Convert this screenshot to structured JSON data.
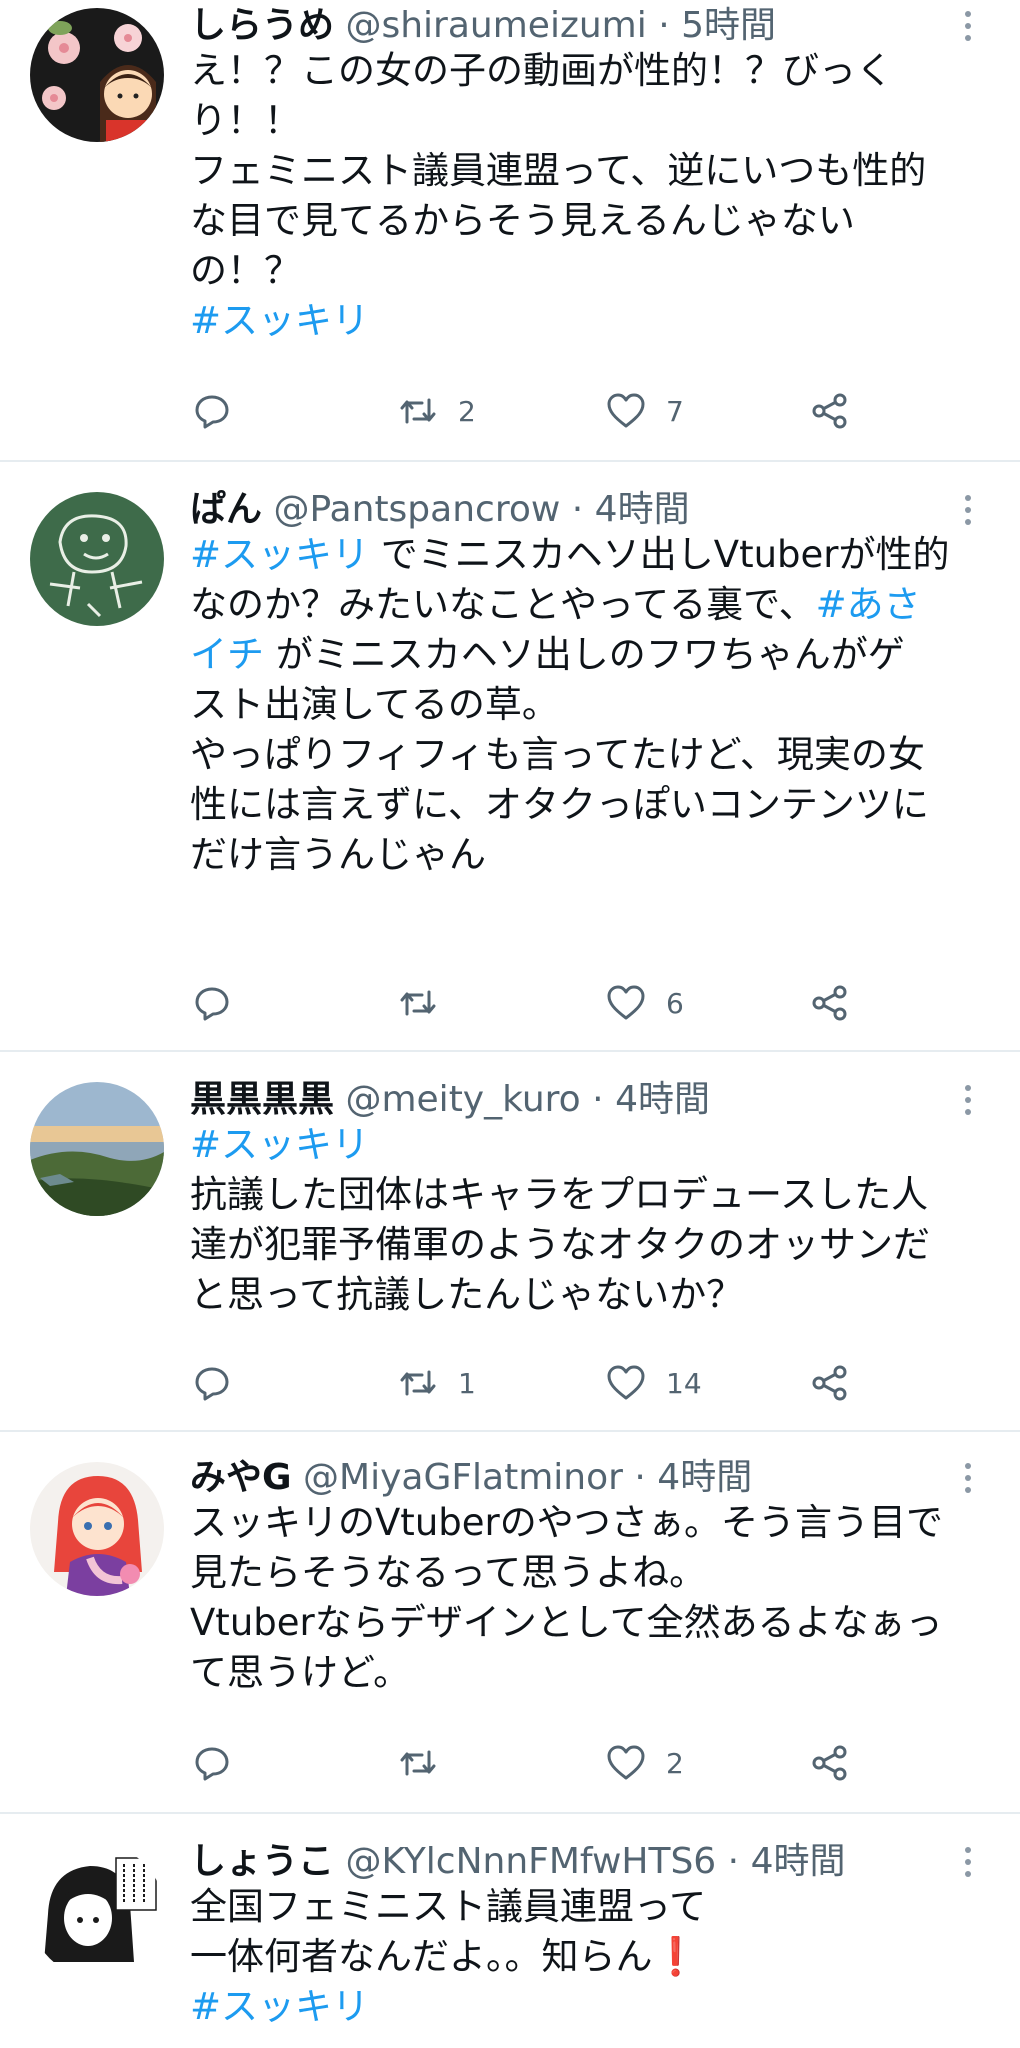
{
  "tweets": [
    {
      "name": "しらうめ",
      "handle": "@shiraumeizumi",
      "separator": "·",
      "time": "5時間",
      "body": [
        [
          {
            "t": "え！？この女の子の動画が性的！？びっく"
          }
        ],
        [
          {
            "t": "り！！"
          }
        ],
        [
          {
            "t": "フェミニスト議員連盟って、逆にいつも性的"
          }
        ],
        [
          {
            "t": "な目で見てるからそう見えるんじゃない"
          }
        ],
        [
          {
            "t": "の！？"
          }
        ],
        [
          {
            "t": "#スッキリ",
            "tag": true
          }
        ]
      ],
      "reply_count": "",
      "retweet_count": "2",
      "like_count": "7",
      "avatar_icon": "flower-girl-avatar"
    },
    {
      "name": "ぱん",
      "handle": "@Pantspancrow",
      "separator": "·",
      "time": "4時間",
      "body": [
        [
          {
            "t": "#スッキリ",
            "tag": true
          },
          {
            "t": " でミニスカヘソ出しVtuberが性的"
          }
        ],
        [
          {
            "t": "なのか？みたいなことやってる裏で、"
          },
          {
            "t": "#あさ",
            "tag": true
          }
        ],
        [
          {
            "t": "イチ",
            "tag": true
          },
          {
            "t": " がミニスカヘソ出しのフワちゃんがゲ"
          }
        ],
        [
          {
            "t": "スト出演してるの草。"
          }
        ],
        [
          {
            "t": " "
          }
        ],
        [
          {
            "t": "やっぱりフィフィも言ってたけど、現実の女"
          }
        ],
        [
          {
            "t": "性には言えずに、オタクっぽいコンテンツに"
          }
        ],
        [
          {
            "t": "だけ言うんじゃん"
          }
        ]
      ],
      "reply_count": "",
      "retweet_count": "",
      "like_count": "6",
      "avatar_icon": "chalk-drawing-avatar"
    },
    {
      "name": "黒黒黒黒",
      "handle": "@meity_kuro",
      "separator": "·",
      "time": "4時間",
      "body": [
        [
          {
            "t": "#スッキリ",
            "tag": true
          }
        ],
        [
          {
            "t": "抗議した団体はキャラをプロデュースした人"
          }
        ],
        [
          {
            "t": "達が犯罪予備軍のようなオタクのオッサンだ"
          }
        ],
        [
          {
            "t": "と思って抗議したんじゃないか？"
          }
        ]
      ],
      "reply_count": "",
      "retweet_count": "1",
      "like_count": "14",
      "avatar_icon": "landscape-avatar"
    },
    {
      "name": "みやG",
      "handle": "@MiyaGFlatminor",
      "separator": "·",
      "time": "4時間",
      "body": [
        [
          {
            "t": "スッキリのVtuberのやつさぁ。そう言う目で"
          }
        ],
        [
          {
            "t": "見たらそうなるって思うよね。"
          }
        ],
        [
          {
            "t": "Vtuberならデザインとして全然あるよなぁっ"
          }
        ],
        [
          {
            "t": "て思うけど。"
          }
        ]
      ],
      "reply_count": "",
      "retweet_count": "",
      "like_count": "2",
      "avatar_icon": "anime-girl-avatar"
    },
    {
      "name": "しょうこ",
      "handle": "@KYlcNnnFMfwHTS6",
      "separator": "·",
      "time": "4時間",
      "body": [
        [
          {
            "t": "全国フェミニスト議員連盟って"
          }
        ],
        [
          {
            "t": "一体何者なんだよ。。知らん"
          },
          {
            "t": "❗",
            "emoji": true
          }
        ],
        [
          {
            "t": "#スッキリ",
            "tag": true
          }
        ]
      ],
      "reply_count": "",
      "retweet_count": "",
      "like_count": "",
      "avatar_icon": "manga-sketch-avatar"
    }
  ],
  "colors": {
    "link": "#1d9bf0",
    "text": "#0f1419",
    "muted": "#536471",
    "divider": "#e6ecf0",
    "emoji_red": "#d0021b"
  }
}
